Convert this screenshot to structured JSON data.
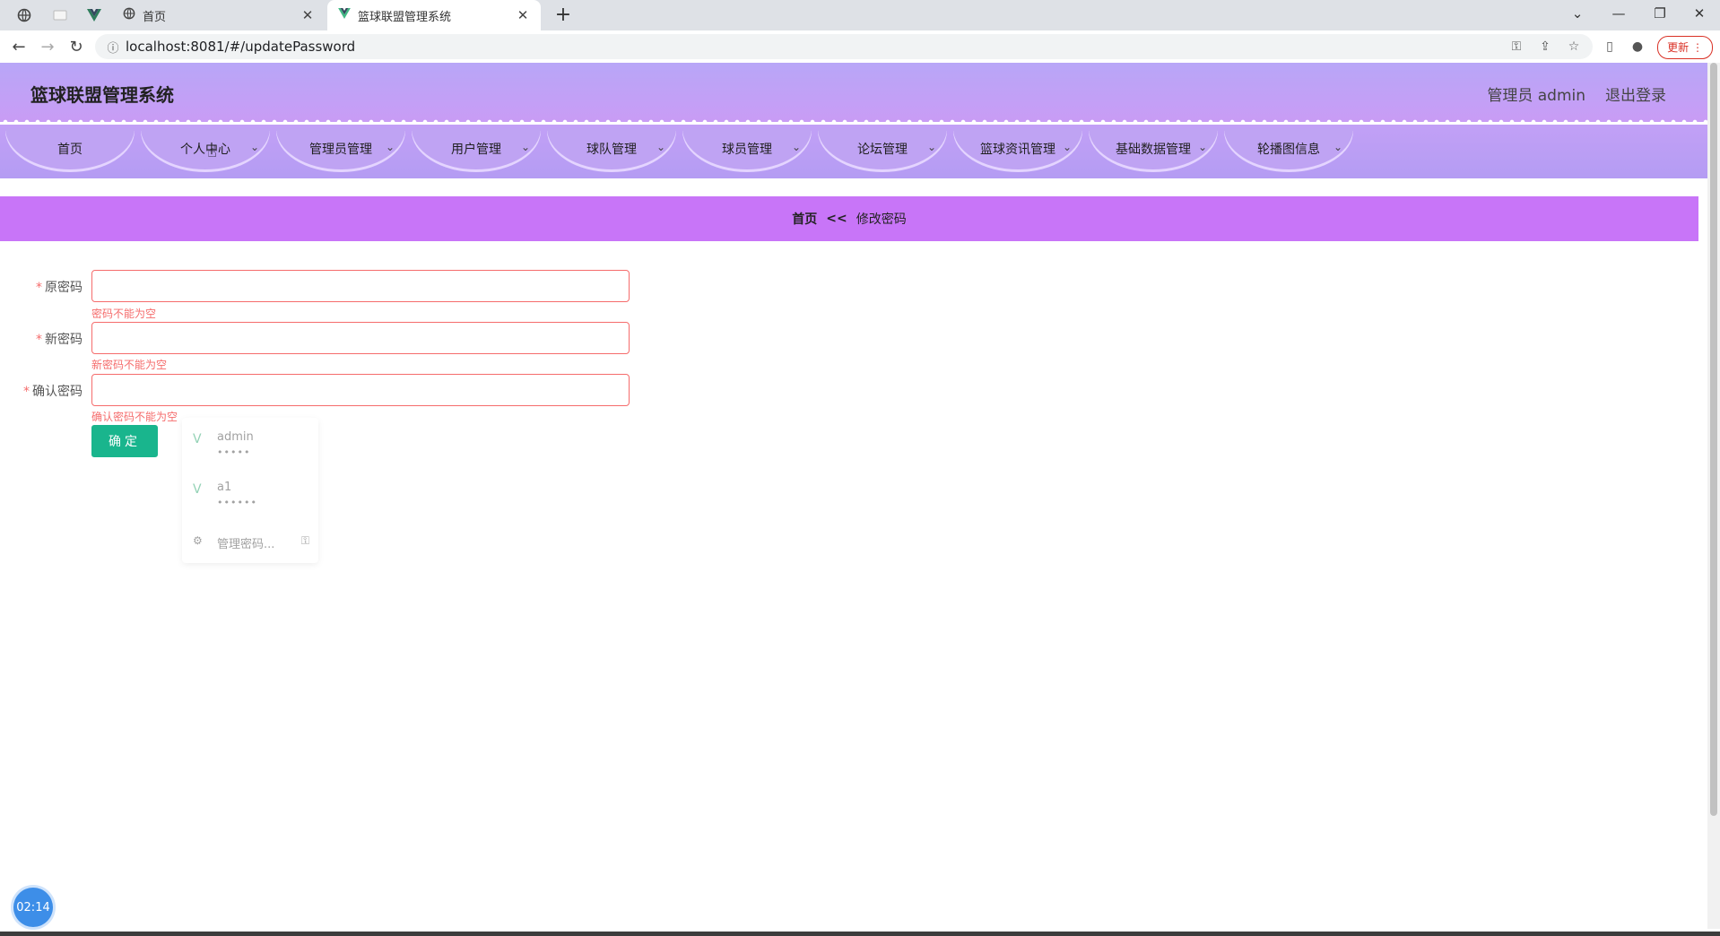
{
  "browser": {
    "tabs": [
      {
        "title": "首页",
        "active": false
      },
      {
        "title": "篮球联盟管理系统",
        "active": true
      }
    ],
    "new_tab_label": "+",
    "url": "localhost:8081/#/updatePassword",
    "update_label": "更新"
  },
  "app": {
    "title": "篮球联盟管理系统",
    "user_label": "管理员 admin",
    "logout_label": "退出登录"
  },
  "menu": {
    "items": [
      {
        "label": "首页",
        "has_dropdown": false
      },
      {
        "label": "个人中心",
        "has_dropdown": true
      },
      {
        "label": "管理员管理",
        "has_dropdown": true
      },
      {
        "label": "用户管理",
        "has_dropdown": true
      },
      {
        "label": "球队管理",
        "has_dropdown": true
      },
      {
        "label": "球员管理",
        "has_dropdown": true
      },
      {
        "label": "论坛管理",
        "has_dropdown": true
      },
      {
        "label": "篮球资讯管理",
        "has_dropdown": true
      },
      {
        "label": "基础数据管理",
        "has_dropdown": true
      },
      {
        "label": "轮播图信息",
        "has_dropdown": true
      }
    ]
  },
  "breadcrumb": {
    "home": "首页",
    "separator": "<<",
    "current": "修改密码"
  },
  "form": {
    "required_mark": "*",
    "fields": [
      {
        "label": "原密码",
        "value": "",
        "error": "密码不能为空"
      },
      {
        "label": "新密码",
        "value": "",
        "error": "新密码不能为空"
      },
      {
        "label": "确认密码",
        "value": "",
        "error": "确认密码不能为空"
      }
    ],
    "submit_label": "确定"
  },
  "password_popup": {
    "entries": [
      {
        "username": "admin",
        "password_mask": "•••••"
      },
      {
        "username": "a1",
        "password_mask": "••••••"
      }
    ],
    "manage_label": "管理密码..."
  },
  "clock": "02:14",
  "colors": {
    "header_gradient_start": "#b8a6f7",
    "breadcrumb_bg": "#c875f8",
    "submit_bg": "#19b58d",
    "error": "#f56c6c"
  }
}
